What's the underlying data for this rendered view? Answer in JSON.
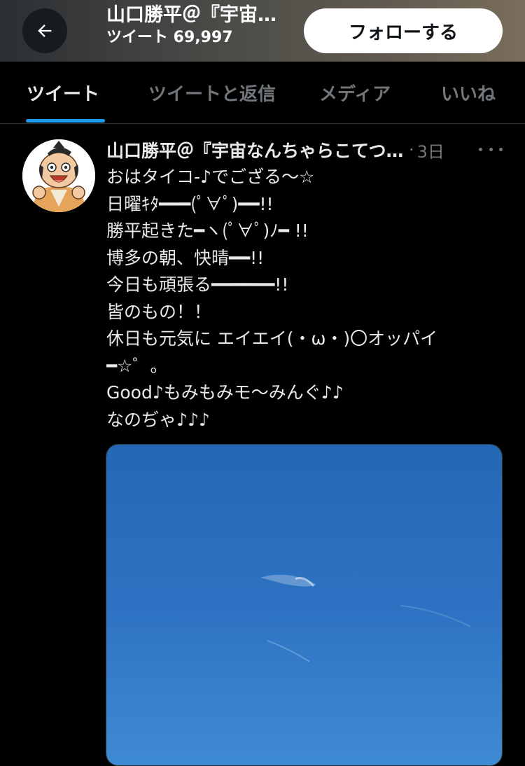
{
  "header": {
    "title": "山口勝平＠『宇宙なんちゃらこてつくん』",
    "tweet_count": "ツイート 69,997",
    "follow_label": "フォローする",
    "back_icon": "arrow-left-icon"
  },
  "tabs": [
    {
      "label": "ツイート",
      "active": true
    },
    {
      "label": "ツイートと返信",
      "active": false
    },
    {
      "label": "メディア",
      "active": false
    },
    {
      "label": "いいね",
      "active": false
    }
  ],
  "colors": {
    "accent": "#1d9bf0",
    "background": "#000000",
    "text_primary": "#e7e9ea",
    "text_secondary": "#71767b",
    "follow_button_bg": "#ffffff"
  },
  "tweet": {
    "author_name": "山口勝平＠『宇宙なんちゃらこてつくん』",
    "separator": "·",
    "time": "3日",
    "more_icon": "more-horizontal-icon",
    "lines": [
      "おはタイコ-♪でござる〜☆",
      "日曜ｷﾀ━━━(ﾟ∀ﾟ)━━!!",
      "勝平起きた━ヽ(ﾟ∀ﾟ)ﾉ━ !!",
      "博多の朝、快晴━━!!",
      "今日も頑張る━━━━━━!!",
      "皆のもの！！",
      "休日も元気に エイエイ(・ω・)〇オッパイ",
      "━☆゜。",
      "Good♪もみもみモ〜みんぐ♪♪",
      "なのぢゃ♪♪♪"
    ],
    "image": "blue-sky-photo"
  }
}
